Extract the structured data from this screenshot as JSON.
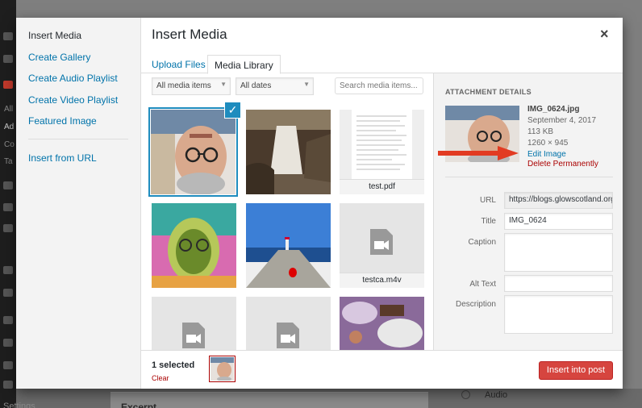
{
  "background": {
    "sidebar_labels": [
      "All",
      "Ad",
      "Co",
      "Ta"
    ],
    "settings_label": "Settings",
    "excerpt_label": "Excerpt",
    "audio_label": "Audio"
  },
  "modal": {
    "title": "Insert Media",
    "close_symbol": "×",
    "menu": {
      "items": [
        {
          "label": "Insert Media"
        },
        {
          "label": "Create Gallery"
        },
        {
          "label": "Create Audio Playlist"
        },
        {
          "label": "Create Video Playlist"
        },
        {
          "label": "Featured Image"
        },
        {
          "label": "Insert from URL"
        }
      ]
    },
    "tabs": [
      {
        "label": "Upload Files"
      },
      {
        "label": "Media Library"
      }
    ],
    "filters": {
      "type_selected": "All media items",
      "date_selected": "All dates",
      "search_placeholder": "Search media items..."
    },
    "grid": {
      "items": [
        {
          "type": "image",
          "alt": "selfie (selected)"
        },
        {
          "type": "image",
          "alt": "waterfall"
        },
        {
          "type": "document",
          "name": "test.pdf"
        },
        {
          "type": "image",
          "alt": "psychedelic portrait"
        },
        {
          "type": "image",
          "alt": "pier with lighthouse"
        },
        {
          "type": "video",
          "name": "testca.m4v"
        },
        {
          "type": "video",
          "name": ""
        },
        {
          "type": "video",
          "name": ""
        },
        {
          "type": "image",
          "alt": "children crafting"
        }
      ],
      "check_symbol": "✓"
    },
    "details": {
      "heading": "Attachment Details",
      "filename": "IMG_0624.jpg",
      "date": "September 4, 2017",
      "size": "113 KB",
      "dimensions": "1260 × 945",
      "edit_link": "Edit Image",
      "delete_link": "Delete Permanently",
      "fields": {
        "url_label": "URL",
        "url_value": "https://blogs.glowscotland.org.uk/",
        "title_label": "Title",
        "title_value": "IMG_0624",
        "caption_label": "Caption",
        "alt_label": "Alt Text",
        "description_label": "Description"
      }
    },
    "footer": {
      "selected_count": "1 selected",
      "clear_label": "Clear",
      "insert_button": "Insert into post"
    },
    "colors": {
      "link": "#0073aa",
      "danger": "#a00000",
      "primary_button": "#d6453f",
      "selection": "#1e8cbe",
      "annotation_arrow": "#e23b22"
    }
  }
}
